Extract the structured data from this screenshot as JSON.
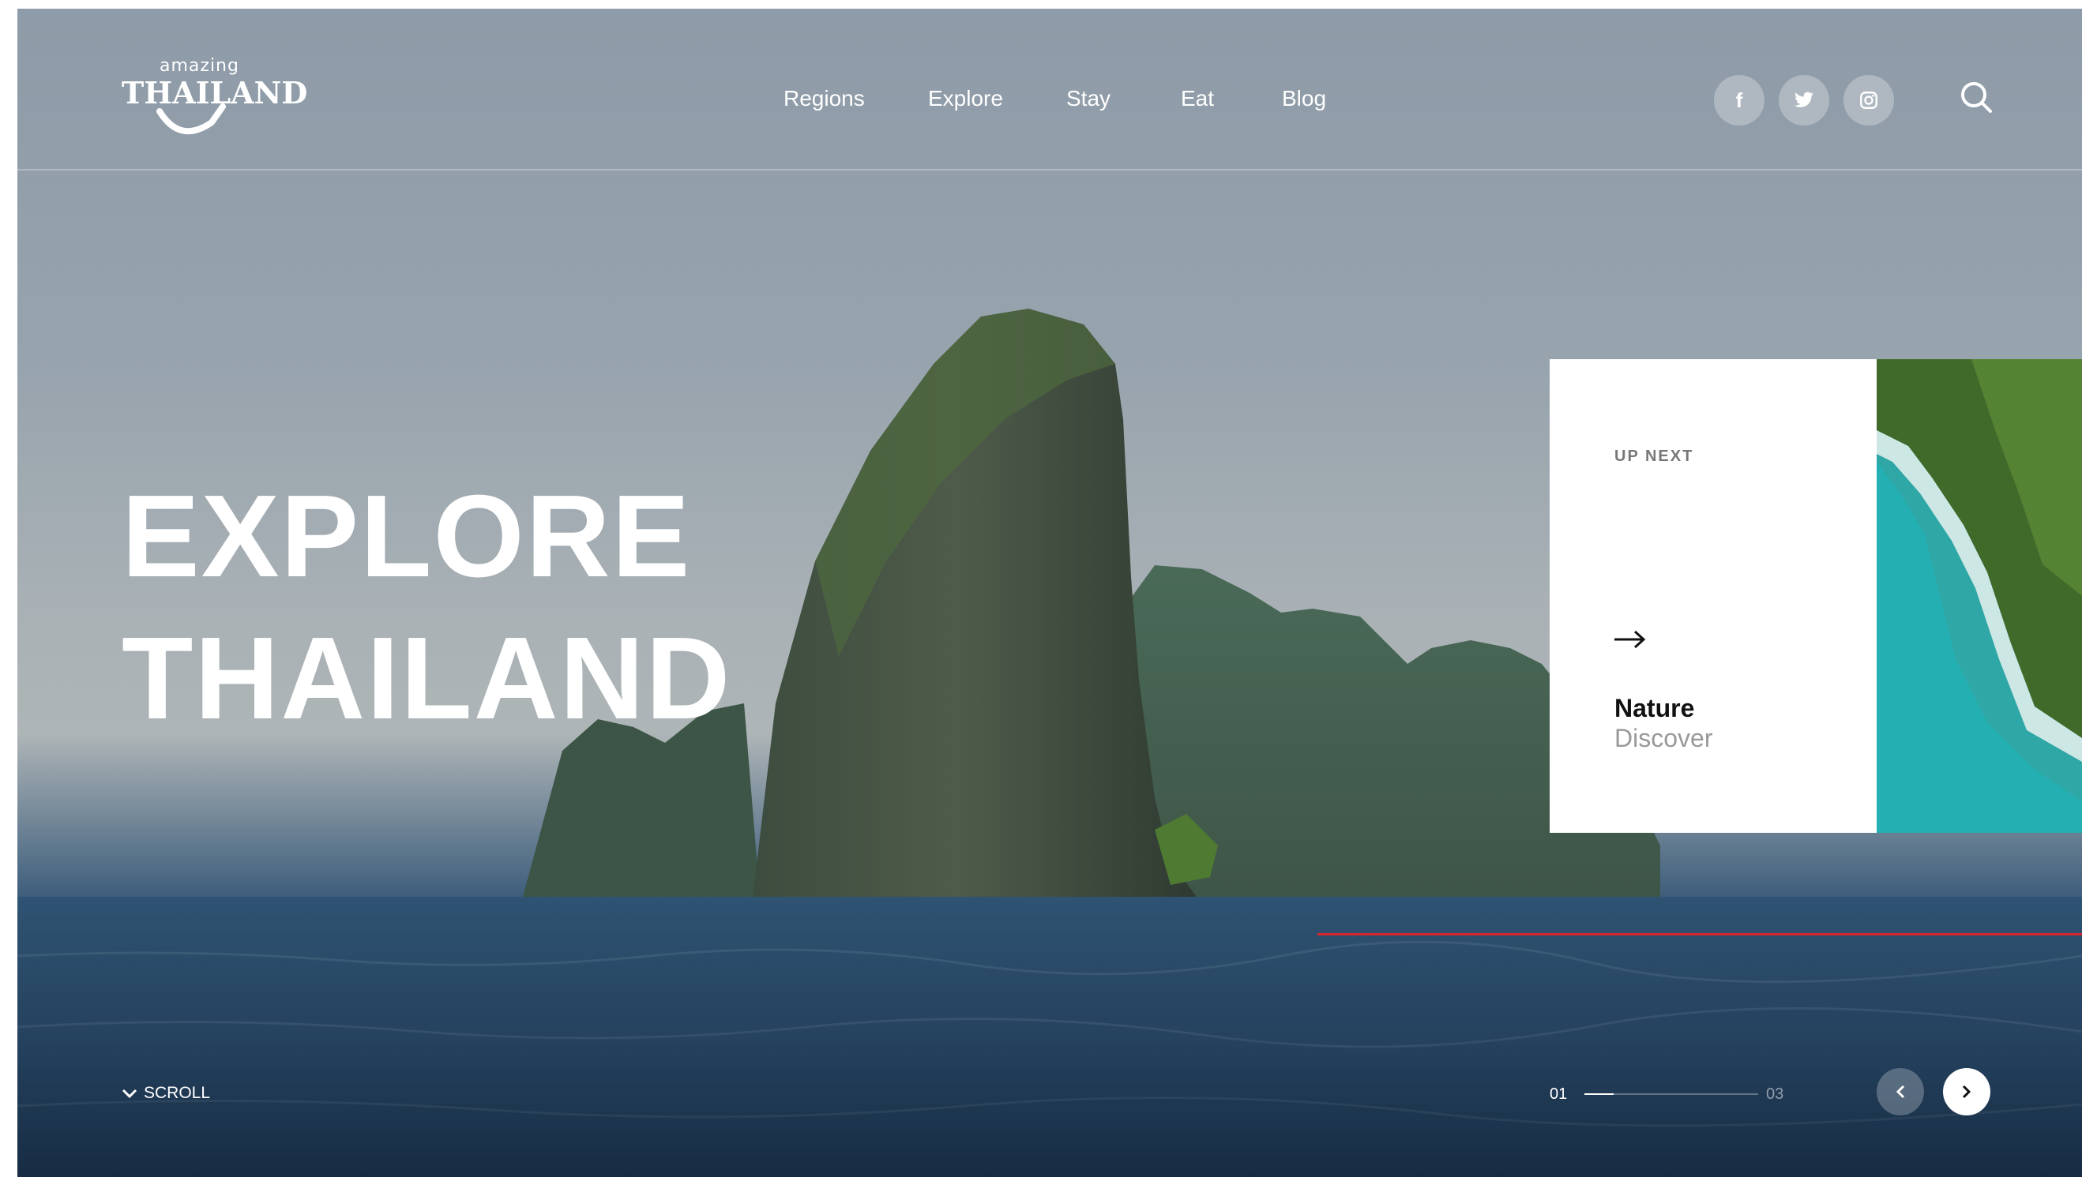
{
  "brand": {
    "tagline": "amazing",
    "name": "THAILAND"
  },
  "nav": {
    "items": [
      {
        "label": "Regions"
      },
      {
        "label": "Explore"
      },
      {
        "label": "Stay"
      },
      {
        "label": "Eat"
      },
      {
        "label": "Blog"
      }
    ]
  },
  "social": {
    "icons": [
      "facebook-icon",
      "twitter-icon",
      "instagram-icon"
    ],
    "facebook_glyph": "f"
  },
  "hero": {
    "line1": "EXPLORE",
    "line2": "THAILAND"
  },
  "up_next": {
    "label": "UP NEXT",
    "title": "Nature",
    "subtitle": "Discover"
  },
  "scroll": {
    "label": "SCROLL"
  },
  "pager": {
    "current": "01",
    "total": "03",
    "progress": 0.17
  },
  "colors": {
    "accent_red": "#d9252e",
    "card_background": "#ffffff"
  }
}
